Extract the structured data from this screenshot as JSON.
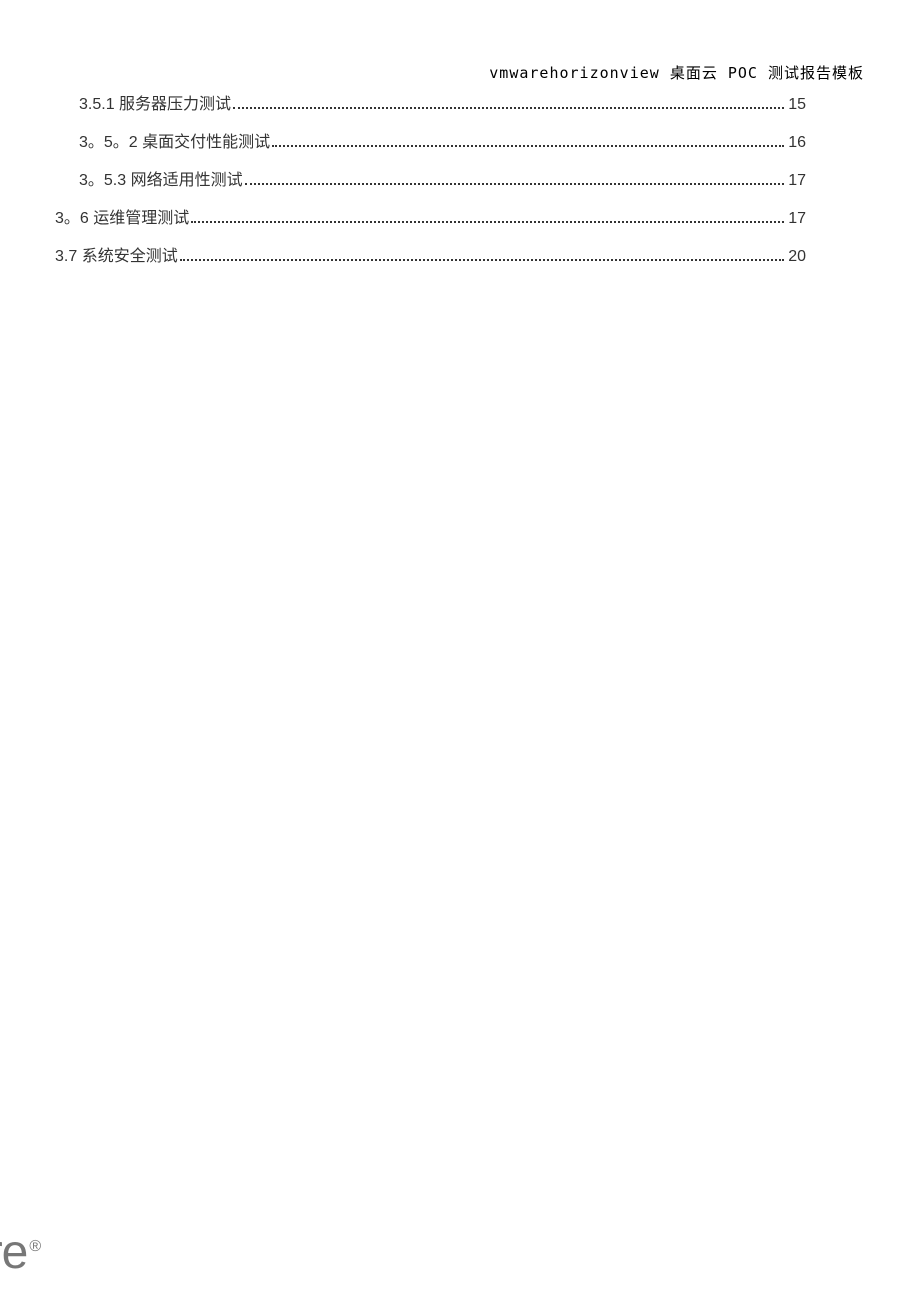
{
  "header": {
    "title": "vmwarehorizonview 桌面云 POC 测试报告模板"
  },
  "toc": {
    "items": [
      {
        "level": 2,
        "label": "3.5.1 服务器压力测试 ",
        "page": "15"
      },
      {
        "level": 2,
        "label": "3。5。2 桌面交付性能测试 ",
        "page": "16"
      },
      {
        "level": 2,
        "label": "3。5.3 网络适用性测试",
        "page": "17"
      },
      {
        "level": 1,
        "label": "3。6 运维管理测试 ",
        "page": "17"
      },
      {
        "level": 1,
        "label": "3.7 系统安全测试",
        "page": "20"
      }
    ]
  },
  "watermark": {
    "text": "vare",
    "reg": "®"
  }
}
